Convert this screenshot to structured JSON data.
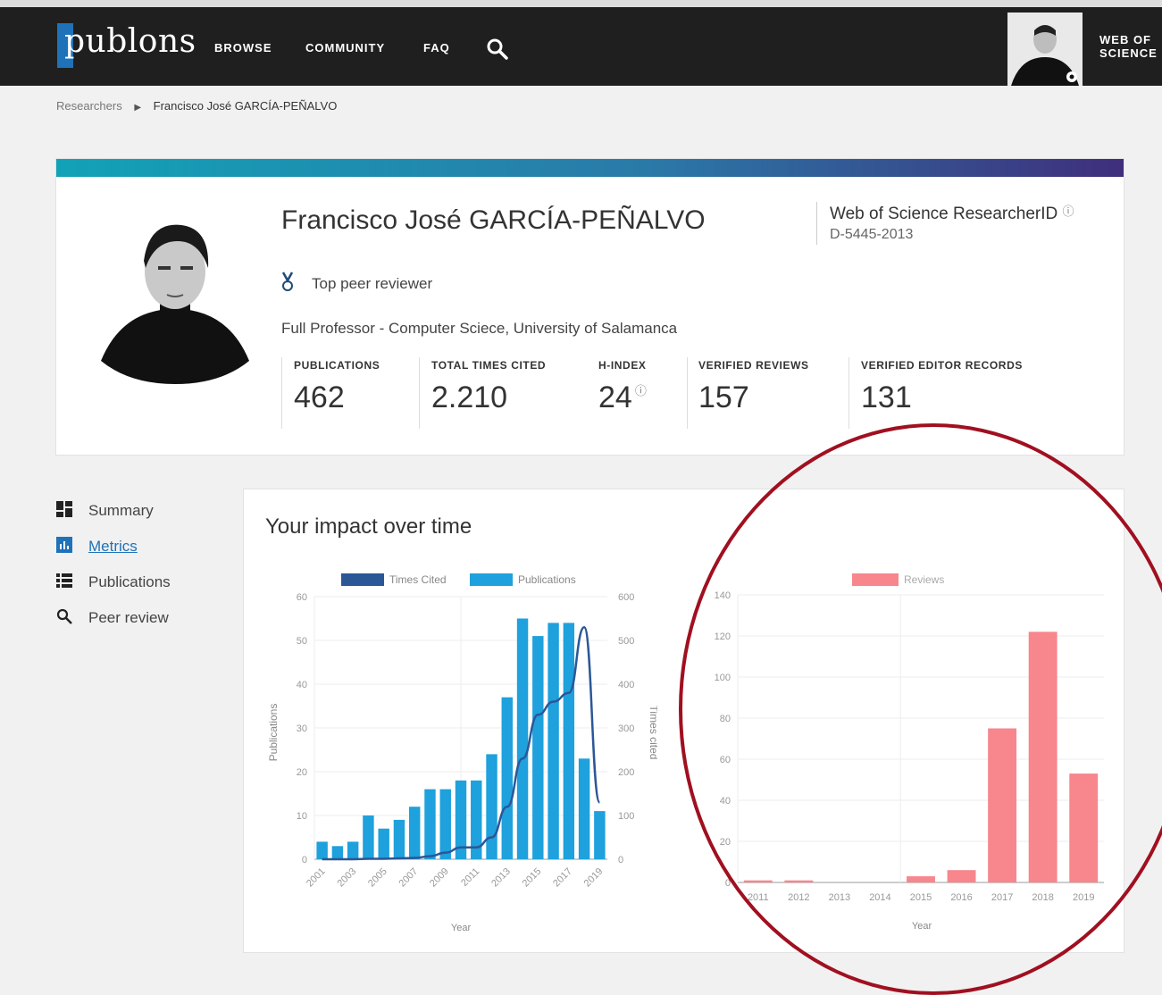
{
  "header": {
    "logo": "publons",
    "nav": [
      "BROWSE",
      "COMMUNITY",
      "FAQ"
    ],
    "wos_line1": "WEB OF",
    "wos_line2": "SCIENCE"
  },
  "breadcrumb": {
    "parent": "Researchers",
    "current": "Francisco José GARCÍA-PEÑALVO"
  },
  "profile": {
    "name": "Francisco José GARCÍA-PEÑALVO",
    "researcherid_title": "Web of Science ResearcherID",
    "researcherid": "D-5445-2013",
    "badge": "Top peer reviewer",
    "affiliation": "Full Professor - Computer Sciece, University of Salamanca",
    "stats": [
      {
        "label": "PUBLICATIONS",
        "value": "462"
      },
      {
        "label": "TOTAL TIMES CITED",
        "value": "2.210"
      },
      {
        "label": "H-INDEX",
        "value": "24"
      },
      {
        "label": "VERIFIED REVIEWS",
        "value": "157"
      },
      {
        "label": "VERIFIED EDITOR RECORDS",
        "value": "131"
      }
    ]
  },
  "sidebar": [
    {
      "label": "Summary",
      "icon": "summary-icon"
    },
    {
      "label": "Metrics",
      "icon": "bar-chart-icon",
      "active": true
    },
    {
      "label": "Publications",
      "icon": "list-icon"
    },
    {
      "label": "Peer review",
      "icon": "search-icon"
    }
  ],
  "panel": {
    "title": "Your impact over time"
  },
  "chart_data": [
    {
      "type": "bar",
      "legend": [
        "Times Cited",
        "Publications"
      ],
      "x": [
        2001,
        2002,
        2003,
        2004,
        2005,
        2006,
        2007,
        2008,
        2009,
        2010,
        2011,
        2012,
        2013,
        2014,
        2015,
        2016,
        2017,
        2018,
        2019
      ],
      "xtick_labels": [
        "2001",
        "2003",
        "2005",
        "2007",
        "2009",
        "2011",
        "2013",
        "2015",
        "2017",
        "2019"
      ],
      "series": [
        {
          "name": "Publications",
          "type": "bar",
          "axis": "left",
          "color": "#1ea1dc",
          "values": [
            4,
            3,
            4,
            10,
            7,
            9,
            12,
            16,
            16,
            18,
            18,
            24,
            37,
            55,
            51,
            54,
            54,
            23,
            11
          ]
        },
        {
          "name": "Times Cited",
          "type": "line",
          "axis": "right",
          "color": "#2b5797",
          "values": [
            0,
            0,
            0,
            1,
            1,
            2,
            3,
            7,
            15,
            27,
            27,
            50,
            120,
            230,
            330,
            360,
            380,
            530,
            130
          ]
        }
      ],
      "ylabel": "Publications",
      "y2label": "Times cited",
      "xlabel": "Year",
      "ylim": [
        0,
        60
      ],
      "y2lim": [
        0,
        600
      ],
      "yticks": [
        "0",
        "10",
        "20",
        "30",
        "40",
        "50",
        "60"
      ],
      "y2ticks": [
        "0",
        "100",
        "200",
        "300",
        "400",
        "500",
        "600"
      ]
    },
    {
      "type": "bar",
      "legend": [
        "Reviews"
      ],
      "categories": [
        "2011",
        "2012",
        "2013",
        "2014",
        "2015",
        "2016",
        "2017",
        "2018",
        "2019"
      ],
      "series": [
        {
          "name": "Reviews",
          "color": "#f7868d",
          "values": [
            1,
            1,
            0,
            0,
            3,
            6,
            75,
            122,
            53
          ]
        }
      ],
      "xlabel": "Year",
      "ylim": [
        0,
        140
      ],
      "yticks": [
        "0",
        "20",
        "40",
        "60",
        "80",
        "100",
        "120",
        "140"
      ]
    }
  ]
}
